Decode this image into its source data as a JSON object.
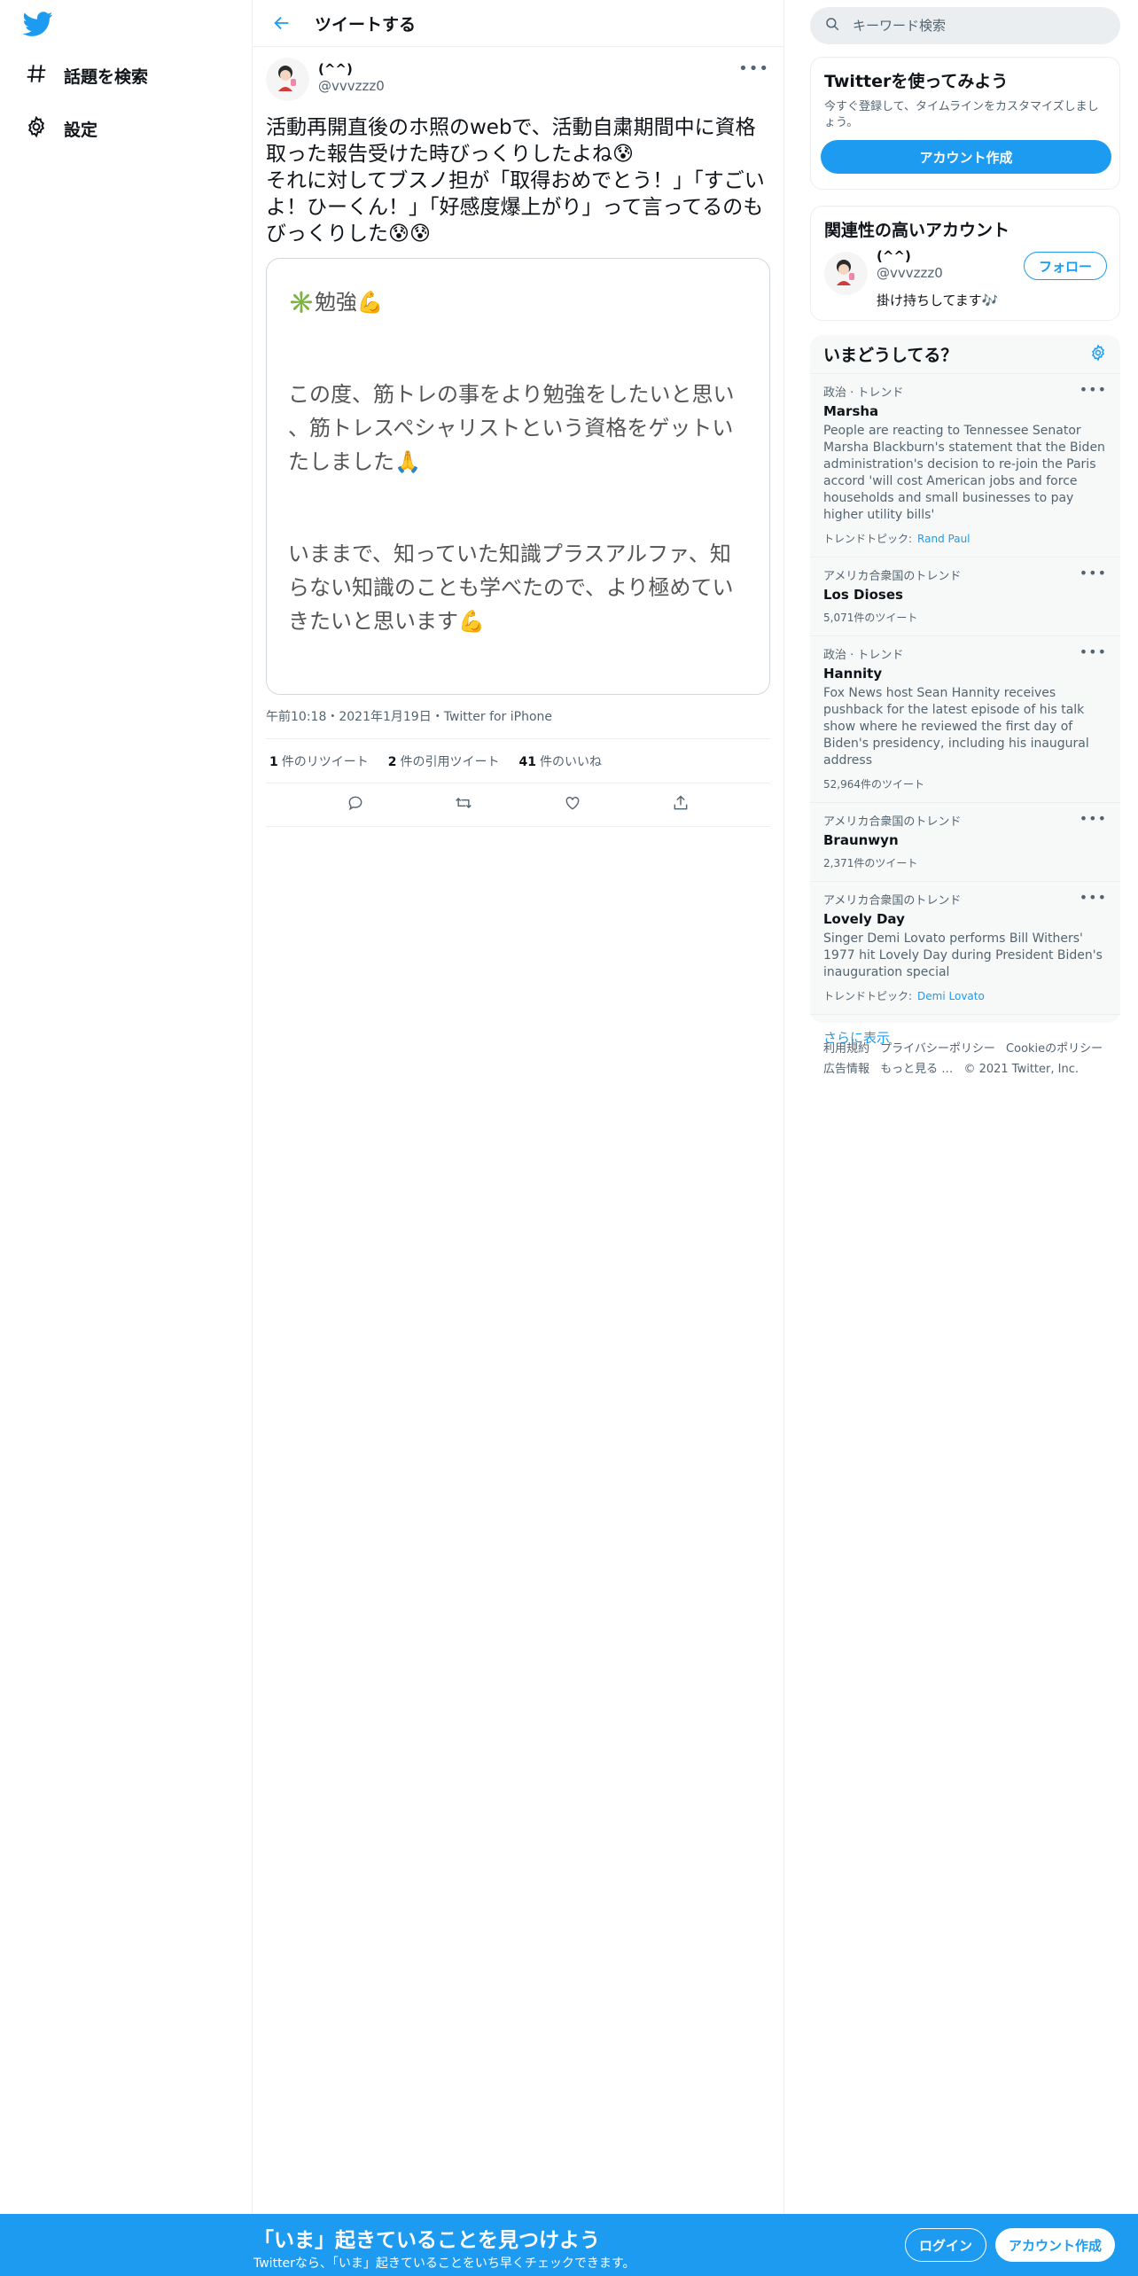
{
  "nav": {
    "items": [
      {
        "label": "話題を検索",
        "icon": "hashtag-icon"
      },
      {
        "label": "設定",
        "icon": "gear-icon"
      }
    ]
  },
  "header": {
    "title": "ツイートする"
  },
  "tweet": {
    "display_name": "(^^)",
    "handle": "@vvvzzz0",
    "text": "活動再開直後のホ照のwebで、活動自粛期間中に資格取った報告受けた時びっくりしたよね😰\nそれに対してブスノ担が「取得おめでとう！」「すごいよ！ひーくん！」「好感度爆上がり」って言ってるのもびっくりした😰😰",
    "card": {
      "line1": "✳️勉強💪",
      "line2": "この度、筋トレの事をより勉強をしたいと思い",
      "line3": "、筋トレスペシャリストという資格をゲットい",
      "line4": "たしました🙏",
      "line5": "いままで、知っていた知識プラスアルファ、知",
      "line6": "らない知識のことも学べたので、より極めてい",
      "line7": "きたいと思います💪"
    },
    "meta": "午前10:18・2021年1月19日・Twitter for iPhone",
    "stats": {
      "retweets_num": "1",
      "retweets_label": "件のリツイート",
      "quotes_num": "2",
      "quotes_label": "件の引用ツイート",
      "likes_num": "41",
      "likes_label": "件のいいね"
    }
  },
  "search": {
    "placeholder": "キーワード検索"
  },
  "signup_panel": {
    "title": "Twitterを使ってみよう",
    "desc": "今すぐ登録して、タイムラインをカスタマイズしましょう。",
    "button": "アカウント作成"
  },
  "related": {
    "title": "関連性の高いアカウント",
    "name": "(^^)",
    "handle": "@vvvzzz0",
    "bio": "掛け持ちしてます🎶",
    "follow": "フォロー"
  },
  "trends": {
    "title": "いまどうしてる？",
    "items": [
      {
        "ctx": "政治 · トレンド",
        "name": "Marsha",
        "desc": "People are reacting to Tennessee Senator Marsha Blackburn's statement that the Biden administration's decision to re-join the Paris accord 'will cost American jobs and force households and small businesses to pay higher utility bills'",
        "foot_label": "トレンドトピック:",
        "foot_topic": "Rand Paul"
      },
      {
        "ctx": "アメリカ合衆国のトレンド",
        "name": "Los Dioses",
        "count": "5,071件のツイート"
      },
      {
        "ctx": "政治 · トレンド",
        "name": "Hannity",
        "desc": "Fox News host Sean Hannity receives pushback for the latest episode of his talk show where he reviewed the first day of Biden's presidency, including his inaugural address",
        "count": "52,964件のツイート"
      },
      {
        "ctx": "アメリカ合衆国のトレンド",
        "name": "Braunwyn",
        "count": "2,371件のツイート"
      },
      {
        "ctx": "アメリカ合衆国のトレンド",
        "name": "Lovely Day",
        "desc": "Singer Demi Lovato performs Bill Withers' 1977 hit Lovely Day during President Biden's inauguration special",
        "foot_label": "トレンドトピック:",
        "foot_topic": "Demi Lovato"
      }
    ],
    "show_more": "さらに表示"
  },
  "footer": {
    "terms": "利用規約",
    "privacy": "プライバシーポリシー",
    "cookie": "Cookieのポリシー",
    "ads": "広告情報",
    "more": "もっと見る …",
    "copyright": "© 2021 Twitter, Inc."
  },
  "bottom_bar": {
    "title": "「いま」起きていることを見つけよう",
    "sub": "Twitterなら、「いま」起きていることをいち早くチェックできます。",
    "login": "ログイン",
    "signup": "アカウント作成"
  },
  "colors": {
    "accent": "#1d9bf0",
    "text": "#0f1419",
    "muted": "#536471",
    "border": "#ebeef0"
  }
}
